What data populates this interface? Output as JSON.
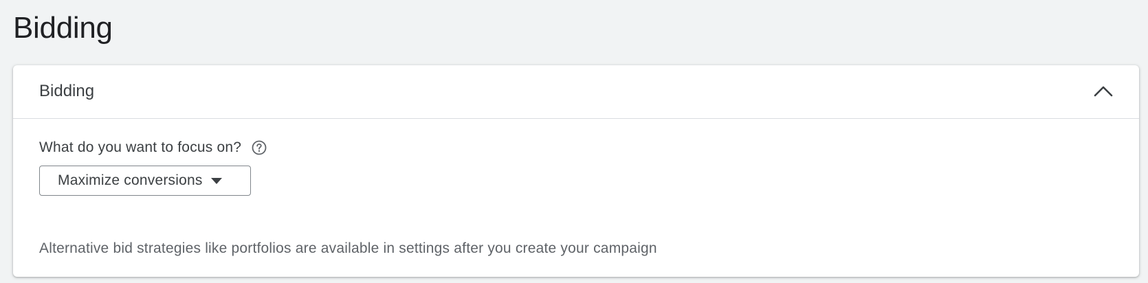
{
  "page": {
    "title": "Bidding"
  },
  "card": {
    "header_title": "Bidding",
    "collapse_icon": "chevron-up-icon",
    "focus_question": "What do you want to focus on?",
    "help_icon": "help-circle-icon",
    "focus_dropdown": {
      "selected": "Maximize conversions",
      "caret_icon": "arrow-drop-down-icon"
    },
    "hint": "Alternative bid strategies like portfolios are available in settings after you create your campaign"
  },
  "colors": {
    "background": "#f1f3f4",
    "card": "#ffffff",
    "text_primary": "#3c4043",
    "text_secondary": "#5f6368",
    "divider": "#dadce0"
  }
}
